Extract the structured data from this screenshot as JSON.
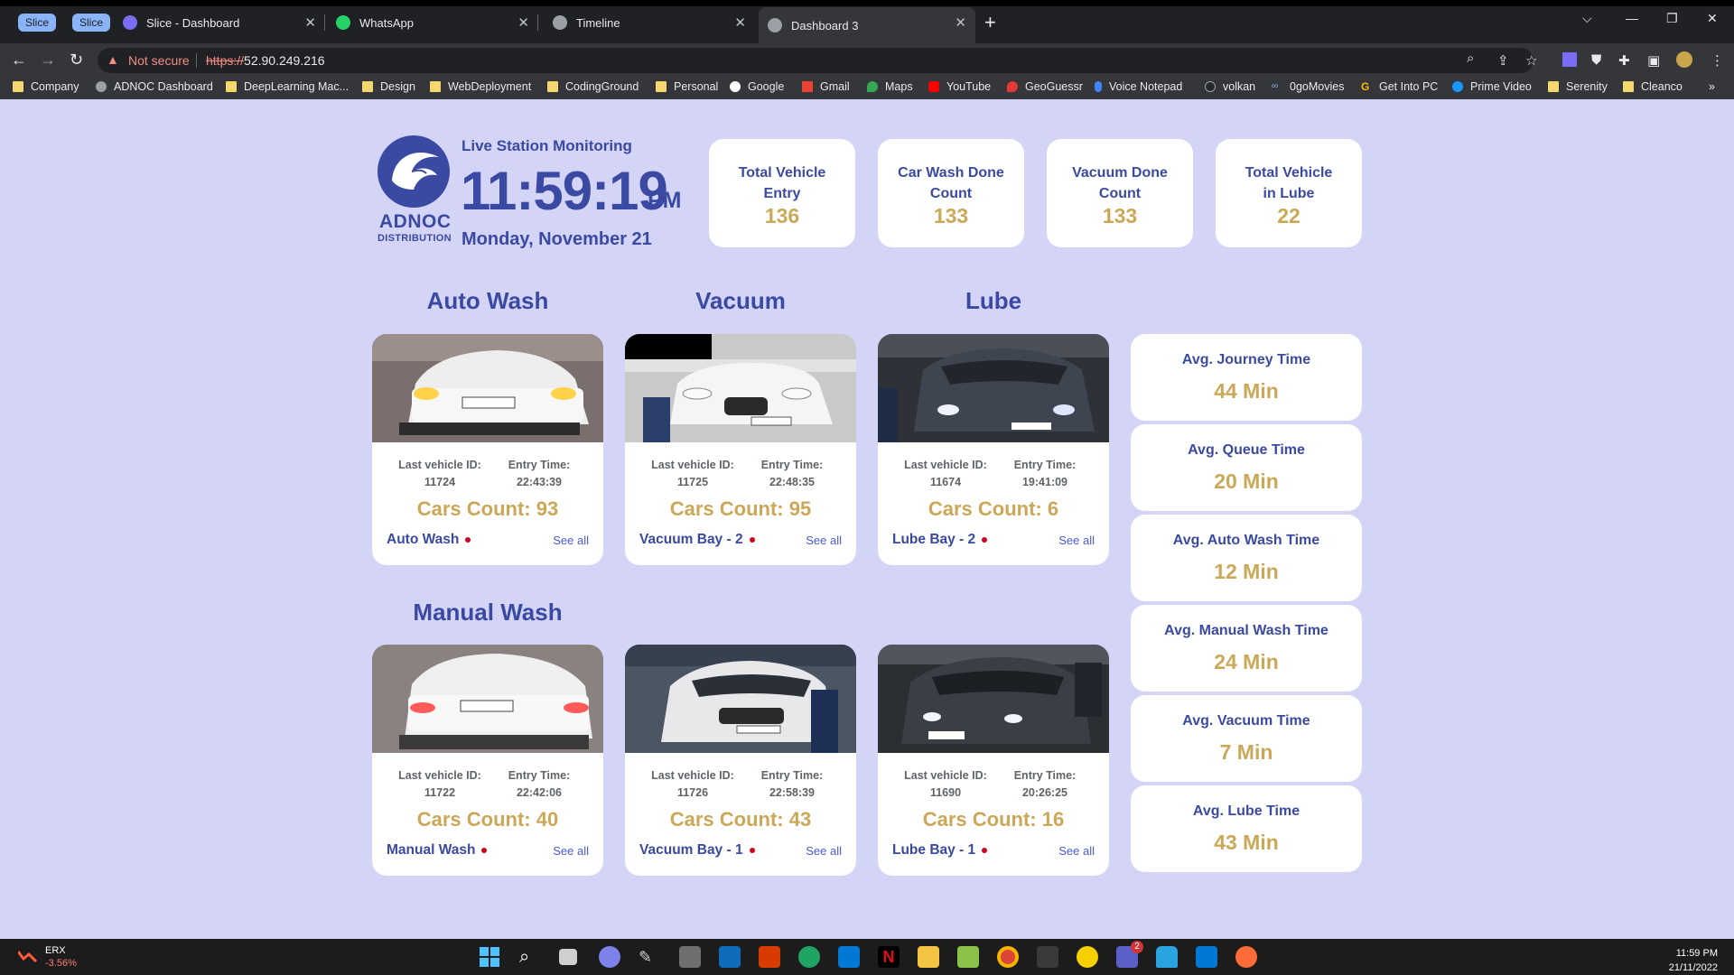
{
  "browser": {
    "tab_groups": [
      "Slice",
      "Slice"
    ],
    "tabs": [
      {
        "title": "Slice - Dashboard"
      },
      {
        "title": "WhatsApp"
      },
      {
        "title": "Timeline"
      },
      {
        "title": "Dashboard 3"
      }
    ],
    "security_label": "Not secure",
    "url_scheme": "https://",
    "url_host": "52.90.249.216",
    "bookmarks": [
      "Company",
      "ADNOC Dashboard",
      "DeepLearning Mac...",
      "Design",
      "WebDeployment",
      "CodingGround",
      "Personal",
      "Google",
      "Gmail",
      "Maps",
      "YouTube",
      "GeoGuessr",
      "Voice Notepad",
      "volkan",
      "0goMovies",
      "Get Into PC",
      "Prime Video",
      "Serenity",
      "Cleanco"
    ]
  },
  "header": {
    "logo_brand": "ADNOC",
    "logo_sub": "DISTRIBUTION",
    "title": "Live Station Monitoring",
    "time": "11:59:19",
    "ampm": "PM",
    "date": "Monday, November 21"
  },
  "stats": [
    {
      "label": "Total Vehicle Entry",
      "value": "136"
    },
    {
      "label": "Car Wash Done Count",
      "value": "133"
    },
    {
      "label": "Vacuum Done Count",
      "value": "133"
    },
    {
      "label": "Total Vehicle in Lube",
      "value": "22"
    }
  ],
  "sections": {
    "auto_wash": "Auto Wash",
    "vacuum": "Vacuum",
    "lube": "Lube",
    "manual_wash": "Manual Wash"
  },
  "cards": [
    {
      "id_label": "Last vehicle ID:",
      "id": "11724",
      "time_label": "Entry Time:",
      "time": "22:43:39",
      "count": "Cars Count: 93",
      "station": "Auto Wash",
      "see_all": "See all"
    },
    {
      "id_label": "Last vehicle ID:",
      "id": "11725",
      "time_label": "Entry Time:",
      "time": "22:48:35",
      "count": "Cars Count: 95",
      "station": "Vacuum Bay - 2",
      "see_all": "See all"
    },
    {
      "id_label": "Last vehicle ID:",
      "id": "11674",
      "time_label": "Entry Time:",
      "time": "19:41:09",
      "count": "Cars Count: 6",
      "station": "Lube Bay - 2",
      "see_all": "See all"
    },
    {
      "id_label": "Last vehicle ID:",
      "id": "11722",
      "time_label": "Entry Time:",
      "time": "22:42:06",
      "count": "Cars Count: 40",
      "station": "Manual Wash",
      "see_all": "See all"
    },
    {
      "id_label": "Last vehicle ID:",
      "id": "11726",
      "time_label": "Entry Time:",
      "time": "22:58:39",
      "count": "Cars Count: 43",
      "station": "Vacuum Bay - 1",
      "see_all": "See all"
    },
    {
      "id_label": "Last vehicle ID:",
      "id": "11690",
      "time_label": "Entry Time:",
      "time": "20:26:25",
      "count": "Cars Count: 16",
      "station": "Lube Bay - 1",
      "see_all": "See all"
    }
  ],
  "averages": [
    {
      "label": "Avg. Journey Time",
      "value": "44 Min"
    },
    {
      "label": "Avg. Queue Time",
      "value": "20 Min"
    },
    {
      "label": "Avg. Auto Wash Time",
      "value": "12 Min"
    },
    {
      "label": "Avg. Manual Wash Time",
      "value": "24 Min"
    },
    {
      "label": "Avg. Vacuum Time",
      "value": "7 Min"
    },
    {
      "label": "Avg. Lube Time",
      "value": "43 Min"
    }
  ],
  "taskbar": {
    "ticker_name": "ERX",
    "ticker_change": "-3.56%",
    "time": "11:59 PM",
    "date": "21/11/2022",
    "teams_badge": "2"
  },
  "colors": {
    "page_bg": "#d4d4f7",
    "primary": "#3a49a1",
    "value_gold": "#cba857",
    "status_dot": "#d0021b"
  }
}
